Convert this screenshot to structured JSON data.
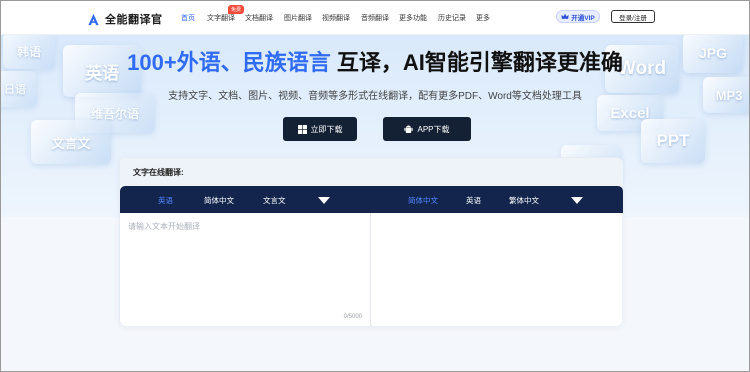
{
  "brand": {
    "name": "全能翻译官",
    "accent": "#2f6bf4"
  },
  "nav": {
    "items": [
      {
        "label": "首页",
        "active": true
      },
      {
        "label": "文字翻译",
        "badge": "免费"
      },
      {
        "label": "文档翻译"
      },
      {
        "label": "图片翻译"
      },
      {
        "label": "视频翻译"
      },
      {
        "label": "音频翻译"
      },
      {
        "label": "更多功能"
      },
      {
        "label": "历史记录"
      },
      {
        "label": "更多"
      }
    ],
    "vip_label": "开通VIP",
    "login_label": "登录/注册"
  },
  "hero": {
    "title_accent": "100+外语、民族语言",
    "title_rest": " 互译，AI智能引擎翻译更准确",
    "subtitle": "支持文字、文档、图片、视频、音频等多形式在线翻译，配有更多PDF、Word等文档处理工具",
    "download_label": "立即下载",
    "app_label": "APP下载",
    "tiles_left": [
      "韩语",
      "英语",
      "日语",
      "维吾尔语",
      "文言文"
    ],
    "tiles_right": [
      "JPG",
      "Word",
      "MP3",
      "Excel",
      "PPT",
      "JPG"
    ]
  },
  "translator": {
    "title": "文字在线翻译:",
    "source_langs": [
      {
        "label": "英语",
        "selected": true
      },
      {
        "label": "简体中文"
      },
      {
        "label": "文言文"
      }
    ],
    "target_langs": [
      {
        "label": "简体中文",
        "selected": true
      },
      {
        "label": "英语"
      },
      {
        "label": "繁体中文"
      }
    ],
    "placeholder": "请输入文本开始翻译",
    "counter": "0/5000"
  }
}
